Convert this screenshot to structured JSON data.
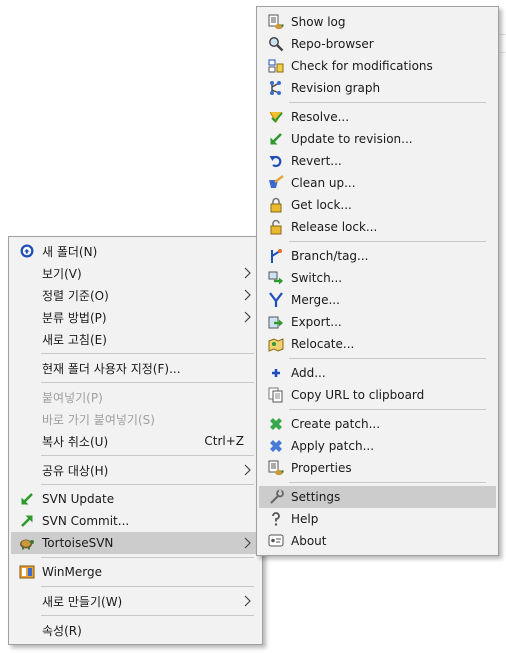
{
  "main_menu": {
    "items": [
      {
        "label": "새 폴더(N)",
        "icon": "new-folder-icon"
      },
      {
        "label": "보기(V)"
      },
      {
        "label": "정렬 기준(O)"
      },
      {
        "label": "분류 방법(P)"
      },
      {
        "label": "새로 고침(E)"
      },
      {
        "label": "현재 폴더 사용자 지정(F)..."
      },
      {
        "label": "붙여넣기(P)"
      },
      {
        "label": "바로 가기 붙여넣기(S)"
      },
      {
        "label": "복사 취소(U)",
        "shortcut": "Ctrl+Z"
      },
      {
        "label": "공유 대상(H)"
      },
      {
        "label": "SVN Update",
        "icon": "svn-update-icon"
      },
      {
        "label": "SVN Commit...",
        "icon": "svn-commit-icon"
      },
      {
        "label": "TortoiseSVN",
        "icon": "tortoise-icon"
      },
      {
        "label": "WinMerge",
        "icon": "winmerge-icon"
      },
      {
        "label": "새로 만들기(W)"
      },
      {
        "label": "속성(R)"
      }
    ]
  },
  "svn_menu": {
    "items": [
      {
        "label": "Show log",
        "icon": "show-log-icon"
      },
      {
        "label": "Repo-browser",
        "icon": "repo-browser-icon"
      },
      {
        "label": "Check for modifications",
        "icon": "check-modifications-icon"
      },
      {
        "label": "Revision graph",
        "icon": "revision-graph-icon"
      },
      {
        "label": "Resolve...",
        "icon": "resolve-icon"
      },
      {
        "label": "Update to revision...",
        "icon": "update-revision-icon"
      },
      {
        "label": "Revert...",
        "icon": "revert-icon"
      },
      {
        "label": "Clean up...",
        "icon": "cleanup-icon"
      },
      {
        "label": "Get lock...",
        "icon": "get-lock-icon"
      },
      {
        "label": "Release lock...",
        "icon": "release-lock-icon"
      },
      {
        "label": "Branch/tag...",
        "icon": "branch-tag-icon"
      },
      {
        "label": "Switch...",
        "icon": "switch-icon"
      },
      {
        "label": "Merge...",
        "icon": "merge-icon"
      },
      {
        "label": "Export...",
        "icon": "export-icon"
      },
      {
        "label": "Relocate...",
        "icon": "relocate-icon"
      },
      {
        "label": "Add...",
        "icon": "add-icon"
      },
      {
        "label": "Copy URL to clipboard",
        "icon": "copy-url-icon"
      },
      {
        "label": "Create patch...",
        "icon": "create-patch-icon"
      },
      {
        "label": "Apply patch...",
        "icon": "apply-patch-icon"
      },
      {
        "label": "Properties",
        "icon": "properties-icon"
      },
      {
        "label": "Settings",
        "icon": "settings-icon"
      },
      {
        "label": "Help",
        "icon": "help-icon"
      },
      {
        "label": "About",
        "icon": "about-icon"
      }
    ]
  },
  "colors": {
    "menu_bg": "#f2f2f2",
    "hover_bg": "#cccccc",
    "disabled_text": "#a0a0a0",
    "text": "#1a1a1a"
  }
}
